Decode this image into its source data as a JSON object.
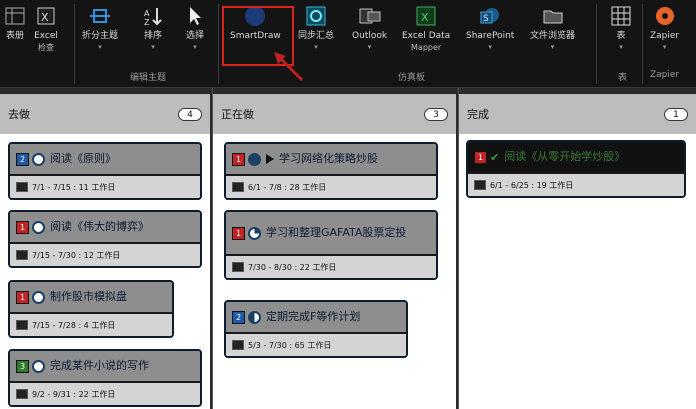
{
  "ribbon": {
    "buttons": [
      {
        "label": "表册",
        "sub": "",
        "icon": "table-icon"
      },
      {
        "label": "Excel",
        "sub": "检查",
        "icon": "excel-icon"
      },
      {
        "label": "折分主题",
        "sub": "",
        "icon": "split-icon"
      },
      {
        "label": "排序",
        "sub": "",
        "icon": "sort-icon"
      },
      {
        "label": "选择",
        "sub": "",
        "icon": "cursor-icon"
      },
      {
        "label": "SmartDraw",
        "sub": "",
        "icon": "smartdraw-icon"
      },
      {
        "label": "同步汇总",
        "sub": "",
        "icon": "sync-icon"
      },
      {
        "label": "Outlook",
        "sub": "",
        "icon": "outlook-icon"
      },
      {
        "label": "Excel Data",
        "sub": "Mapper",
        "icon": "excel-data-icon"
      },
      {
        "label": "SharePoint",
        "sub": "",
        "icon": "sharepoint-icon"
      },
      {
        "label": "文件浏览器",
        "sub": "",
        "icon": "folder-icon"
      },
      {
        "label": "表",
        "sub": "",
        "icon": "grid-icon"
      },
      {
        "label": "Zapier",
        "sub": "",
        "icon": "zapier-icon"
      }
    ],
    "groups": [
      "编辑主题",
      "仿真板",
      "表",
      "Zapier"
    ]
  },
  "lanes": [
    {
      "title": "去做",
      "count": "4",
      "cards": [
        {
          "priority": "2",
          "priority_color": "#1f5aa8",
          "progress": "empty",
          "title": "阅读《原则》",
          "dates": "7/1 - 7/15 : 11 工作日"
        },
        {
          "priority": "1",
          "priority_color": "#c02424",
          "progress": "empty",
          "title": "阅读《伟大的博弈》",
          "dates": "7/15 - 7/30 : 12 工作日"
        },
        {
          "priority": "1",
          "priority_color": "#c02424",
          "progress": "empty",
          "title": "制作股市模拟盘",
          "dates": "7/15 - 7/28 : 4 工作日"
        },
        {
          "priority": "3",
          "priority_color": "#2f7a2f",
          "progress": "empty",
          "title": "完成某件小说的写作",
          "dates": "9/2 - 9/31 : 22 工作日"
        }
      ]
    },
    {
      "title": "正在做",
      "count": "3",
      "cards": [
        {
          "priority": "1",
          "priority_color": "#c02424",
          "progress": "full",
          "title": "学习网络化策略炒股",
          "dates": "6/1 - 7/8 : 28 工作日"
        },
        {
          "priority": "1",
          "priority_color": "#c02424",
          "progress": "q",
          "title": "学习和整理GAFATA股票定投",
          "dates": "7/30 - 8/30 : 22 工作日"
        },
        {
          "priority": "2",
          "priority_color": "#1f5aa8",
          "progress": "half",
          "title": "定期完成F等作计划",
          "dates": "5/3 - 7/30 : 65 工作日"
        }
      ]
    },
    {
      "title": "完成",
      "count": "1",
      "cards": [
        {
          "priority": "1",
          "priority_color": "#c02424",
          "progress": "check",
          "title": "阅读《从零开始学炒股》",
          "dates": "6/1 - 6/25 : 19 工作日"
        }
      ]
    }
  ]
}
